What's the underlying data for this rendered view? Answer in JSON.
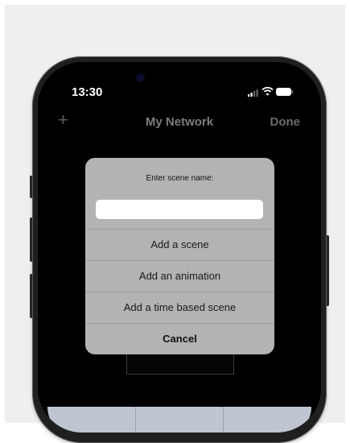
{
  "status_bar": {
    "time": "13:30"
  },
  "nav": {
    "title": "My Network",
    "add_label": "+",
    "done_label": "Done"
  },
  "dialog": {
    "title": "Enter scene name:",
    "input_value": "",
    "input_placeholder": "",
    "actions": [
      {
        "label": "Add a scene"
      },
      {
        "label": "Add an animation"
      },
      {
        "label": "Add a time based scene"
      }
    ],
    "cancel_label": "Cancel"
  },
  "icons": {
    "signal": "cellular-signal-icon",
    "wifi": "wifi-icon",
    "battery": "battery-icon"
  },
  "colors": {
    "dialog_bg": "#b3b3b3",
    "screen_bg": "#000000",
    "bottom_bar": "#bfc6d2"
  }
}
